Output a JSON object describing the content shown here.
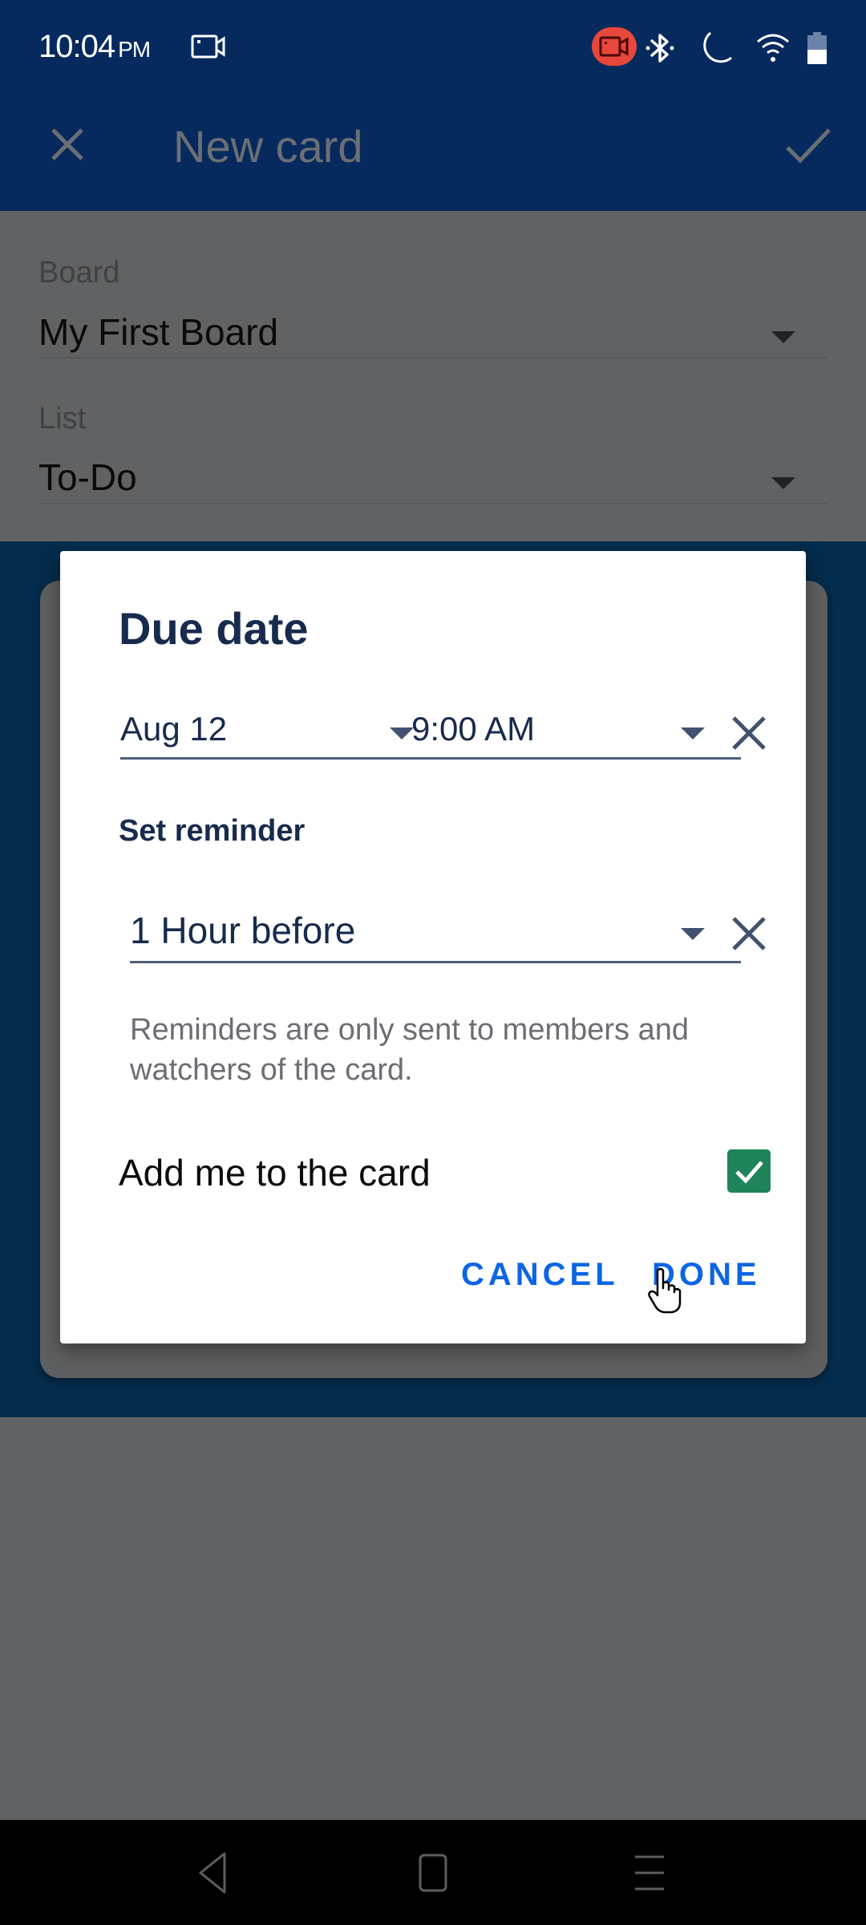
{
  "status_bar": {
    "time": "10:04",
    "ampm": "PM",
    "icons": [
      "screen-record-icon",
      "recording-active-icon",
      "bluetooth-icon",
      "do-not-disturb-moon-icon",
      "wifi-icon",
      "battery-icon"
    ],
    "battery_level_fraction": 0.5,
    "recording_badge_color": "#e8473b"
  },
  "app_bar": {
    "title": "New card",
    "close_icon": "close-icon",
    "confirm_icon": "check-icon",
    "background_color": "#072a5e"
  },
  "form": {
    "board": {
      "label": "Board",
      "value": "My First Board"
    },
    "list": {
      "label": "List",
      "value": "To-Do"
    }
  },
  "dialog": {
    "title": "Due date",
    "date": {
      "value": "Aug 12"
    },
    "time": {
      "value": "9:00 AM"
    },
    "reminder_label": "Set reminder",
    "reminder": {
      "value": "1 Hour before"
    },
    "hint": "Reminders are only sent to members and watchers of the card.",
    "add_me": {
      "label": "Add me to the card",
      "checked": true,
      "color": "#1f845a"
    },
    "buttons": {
      "cancel": "CANCEL",
      "done": "DONE"
    },
    "accent_color": "#0c66e4"
  },
  "nav_bar": {
    "buttons": [
      "back-icon",
      "home-icon",
      "recents-icon"
    ]
  }
}
